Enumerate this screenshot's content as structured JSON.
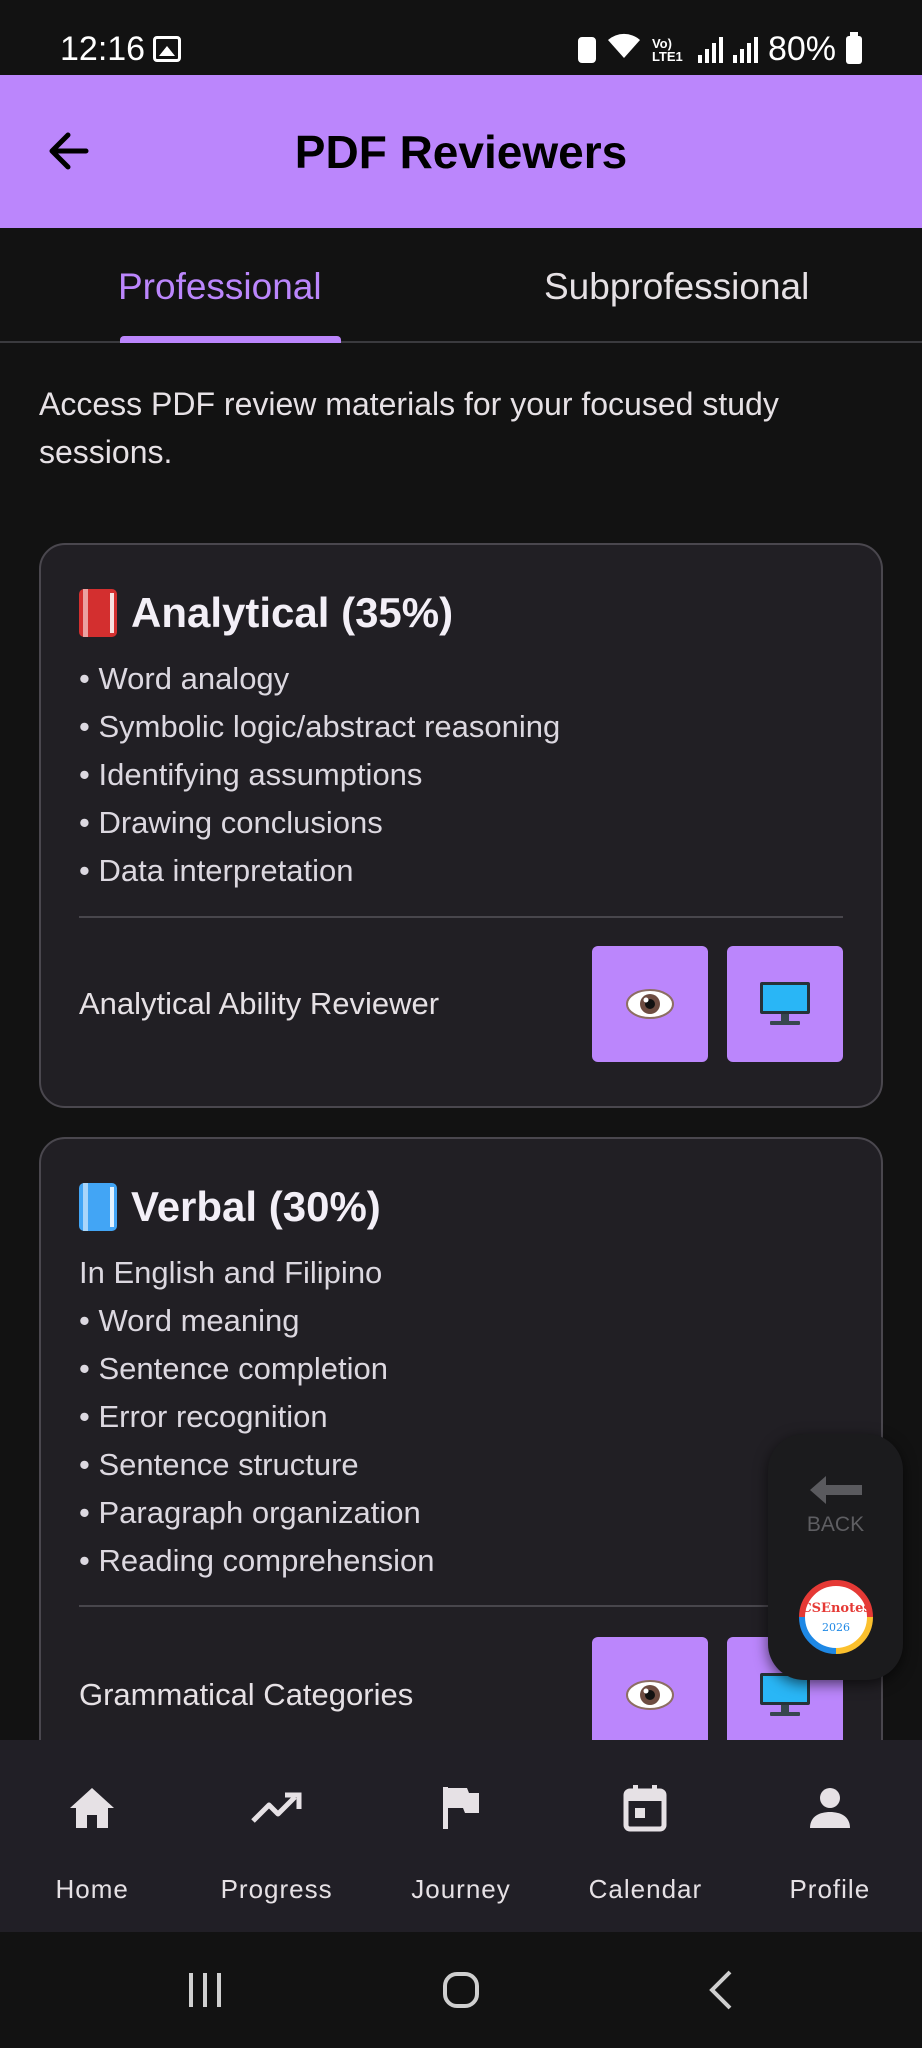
{
  "status_bar": {
    "time": "12:16",
    "battery_percent": "80%",
    "network_label": "Vo) LTE1"
  },
  "header": {
    "title": "PDF Reviewers",
    "back_icon": "arrow-left-icon",
    "background_color": "#bb86fc"
  },
  "tabs": [
    {
      "label": "Professional",
      "active": true
    },
    {
      "label": "Subprofessional",
      "active": false
    }
  ],
  "intro_text": "Access PDF review materials for your focused study sessions.",
  "cards": [
    {
      "title": "Analytical (35%)",
      "icon": "red-book-icon",
      "subtitle": "",
      "items": [
        "• Word analogy",
        "• Symbolic logic/abstract reasoning",
        "• Identifying assumptions",
        "• Drawing conclusions",
        "• Data interpretation"
      ],
      "reviewer": {
        "name": "Analytical Ability Reviewer",
        "view_icon": "eye-icon",
        "present_icon": "monitor-icon"
      }
    },
    {
      "title": "Verbal (30%)",
      "icon": "blue-book-icon",
      "subtitle": "In English and Filipino",
      "items": [
        "• Word meaning",
        "• Sentence completion",
        "• Error recognition",
        "• Sentence structure",
        "• Paragraph organization",
        "• Reading comprehension"
      ],
      "reviewer": {
        "name": "Grammatical Categories",
        "view_icon": "eye-icon",
        "present_icon": "monitor-icon"
      }
    }
  ],
  "floating_widget": {
    "back_label": "BACK",
    "logo_text": "CSEnotes",
    "logo_year": "2026"
  },
  "bottom_nav": [
    {
      "label": "Home",
      "icon": "home-icon"
    },
    {
      "label": "Progress",
      "icon": "trending-up-icon"
    },
    {
      "label": "Journey",
      "icon": "flag-icon"
    },
    {
      "label": "Calendar",
      "icon": "calendar-icon"
    },
    {
      "label": "Profile",
      "icon": "person-icon"
    }
  ],
  "accent_color": "#bb86fc"
}
